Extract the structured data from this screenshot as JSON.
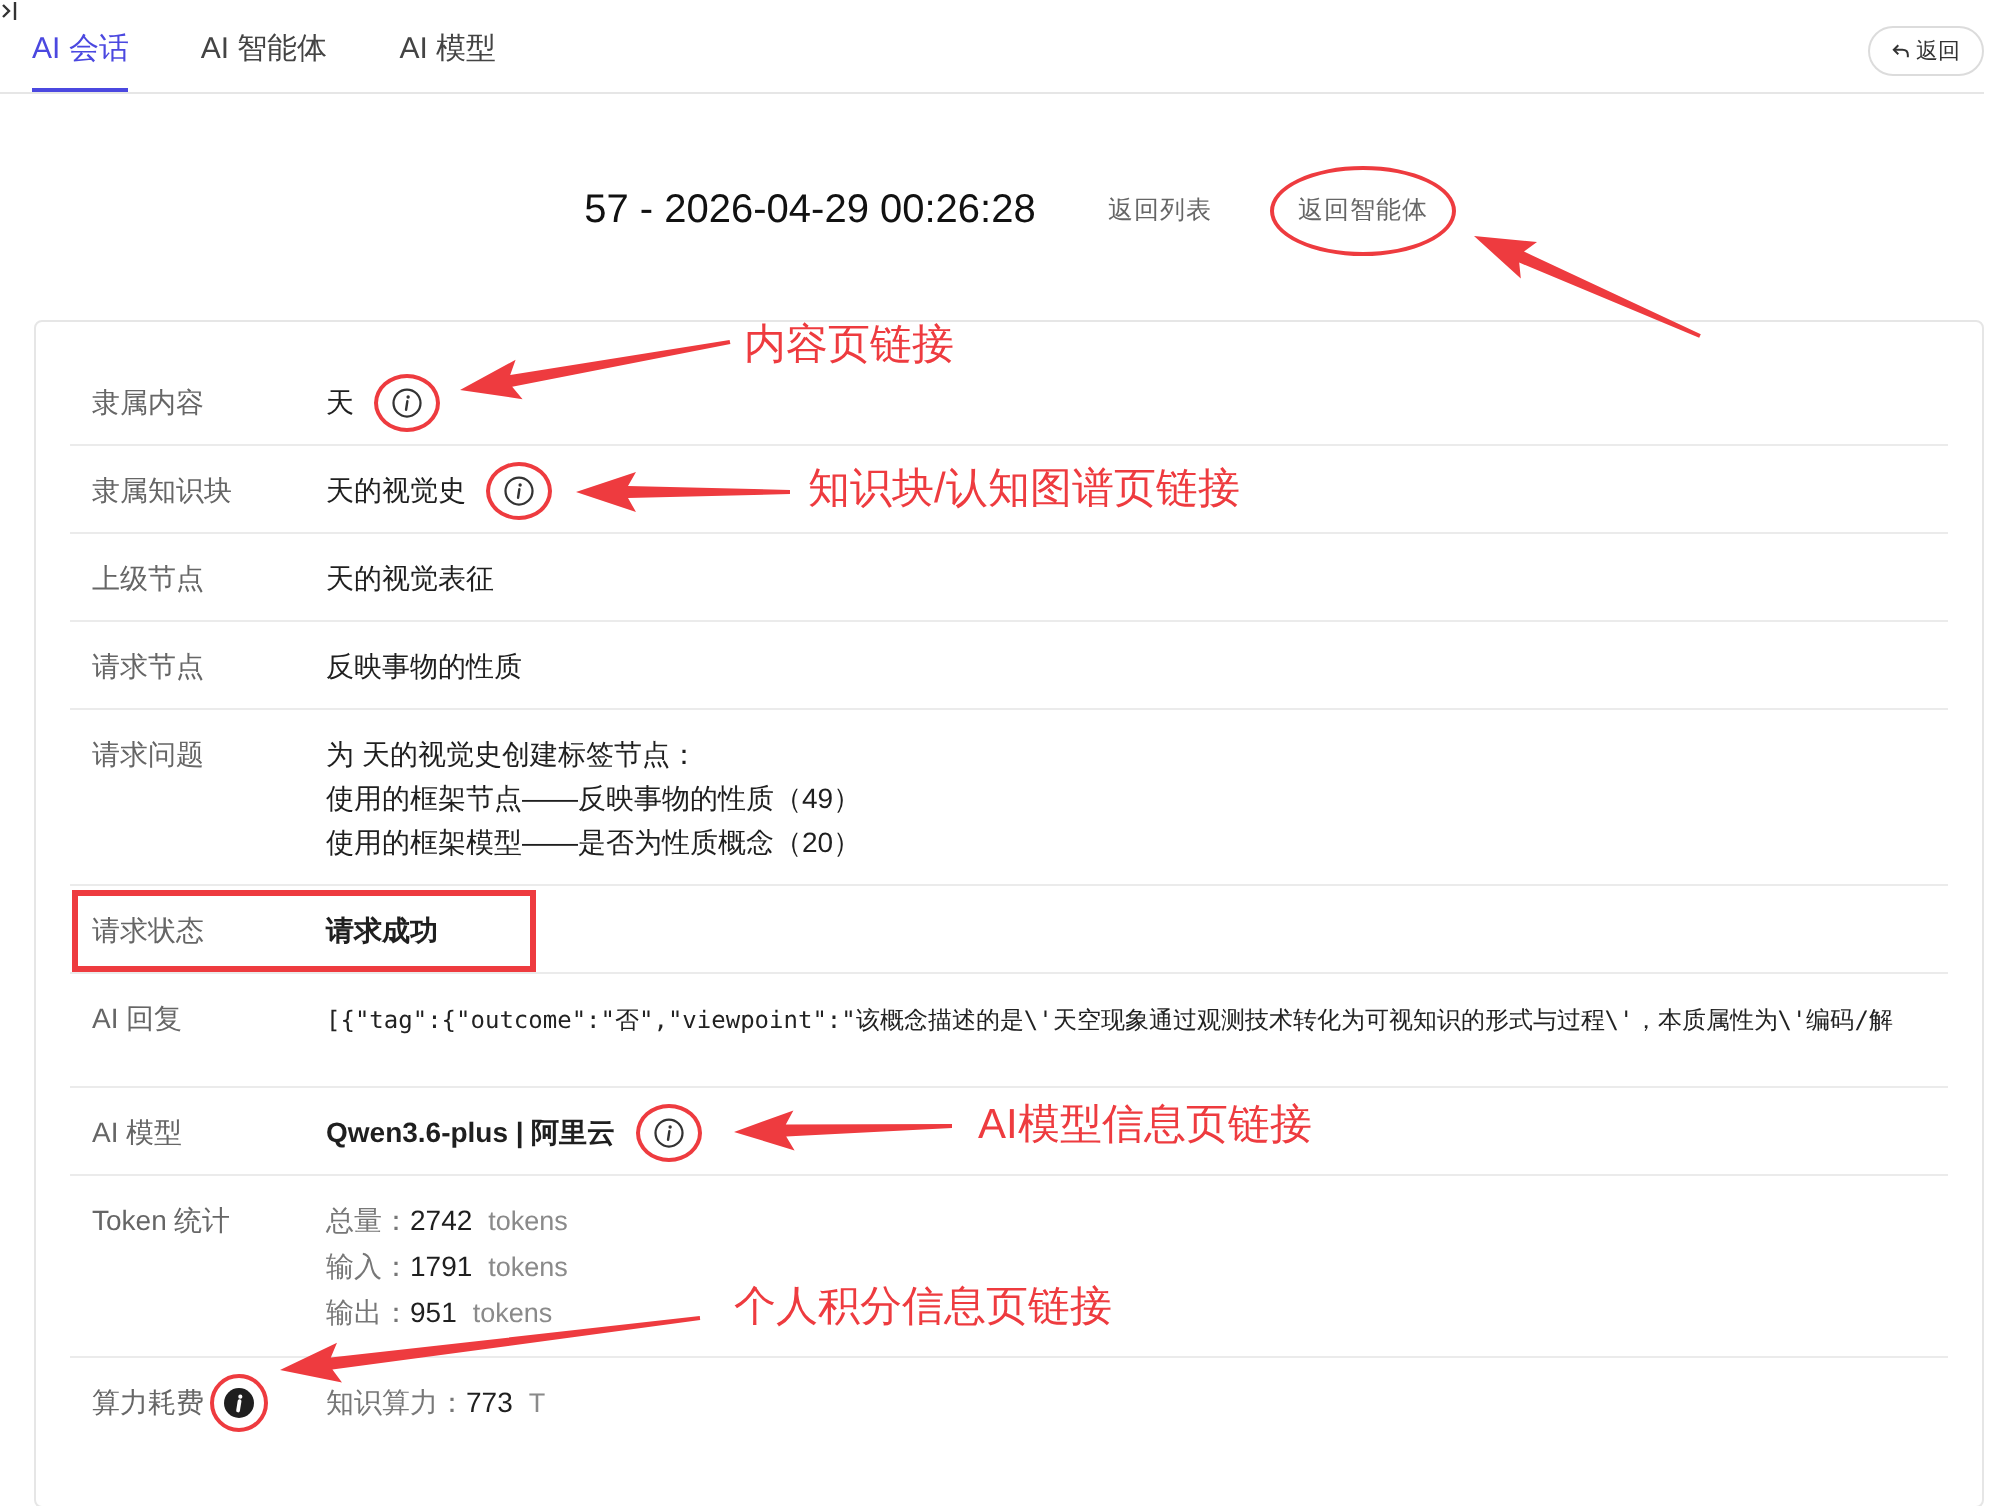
{
  "tabs": [
    {
      "label": "AI 会话",
      "selected": true
    },
    {
      "label": "AI 智能体",
      "selected": false
    },
    {
      "label": "AI 模型",
      "selected": false
    }
  ],
  "back_button": {
    "label": "返回"
  },
  "header": {
    "title": "57 - 2026-04-29 00:26:28",
    "links": [
      {
        "label": "返回列表",
        "highlighted": false
      },
      {
        "label": "返回智能体",
        "highlighted": true
      }
    ]
  },
  "details": [
    {
      "kind": "text",
      "label": "隶属内容",
      "value": "天",
      "highlighted": false,
      "value_info": {
        "highlighted": true
      }
    },
    {
      "kind": "text",
      "label": "隶属知识块",
      "value": "天的视觉史",
      "highlighted": false,
      "value_info": {
        "highlighted": true
      }
    },
    {
      "kind": "text",
      "label": "上级节点",
      "value": "天的视觉表征",
      "highlighted": false
    },
    {
      "kind": "text",
      "label": "请求节点",
      "value": "反映事物的性质",
      "highlighted": false
    },
    {
      "kind": "lines",
      "label": "请求问题",
      "highlighted": false,
      "lines": [
        "为 天的视觉史创建标签节点：",
        "使用的框架节点——反映事物的性质（49）",
        "使用的框架模型——是否为性质概念（20）"
      ]
    },
    {
      "kind": "strong",
      "label": "请求状态",
      "value": "请求成功",
      "highlighted": true
    },
    {
      "kind": "code",
      "label": "AI 回复",
      "highlighted": false,
      "value": "[{\"tag\":{\"outcome\":\"否\",\"viewpoint\":\"该概念描述的是\\'天空现象通过观测技术转化为可视知识的形式与过程\\'，本质属性为\\'编码/解"
    },
    {
      "kind": "strong",
      "label": "AI 模型",
      "value": "Qwen3.6-plus | 阿里云",
      "highlighted": false,
      "value_info": {
        "highlighted": true
      }
    },
    {
      "kind": "stats",
      "label": "Token 统计",
      "highlighted": false,
      "stats": [
        {
          "label": "总量：",
          "value": "2742",
          "unit": "tokens"
        },
        {
          "label": "输入：",
          "value": "1791",
          "unit": "tokens"
        },
        {
          "label": "输出：",
          "value": "951",
          "unit": "tokens"
        }
      ]
    },
    {
      "kind": "stats",
      "label": "算力耗费",
      "highlighted": false,
      "label_info": {
        "highlighted": true
      },
      "stats": [
        {
          "label": "知识算力：",
          "value": "773",
          "unit": "T"
        }
      ]
    }
  ],
  "annotations": [
    {
      "kind": "arrow"
    },
    {
      "kind": "callout",
      "text": "内容页链接"
    },
    {
      "kind": "callout",
      "text": "知识块/认知图谱页链接"
    },
    {
      "kind": "callout",
      "text": "AI模型信息页链接"
    },
    {
      "kind": "callout",
      "text": "个人积分信息页链接"
    }
  ]
}
